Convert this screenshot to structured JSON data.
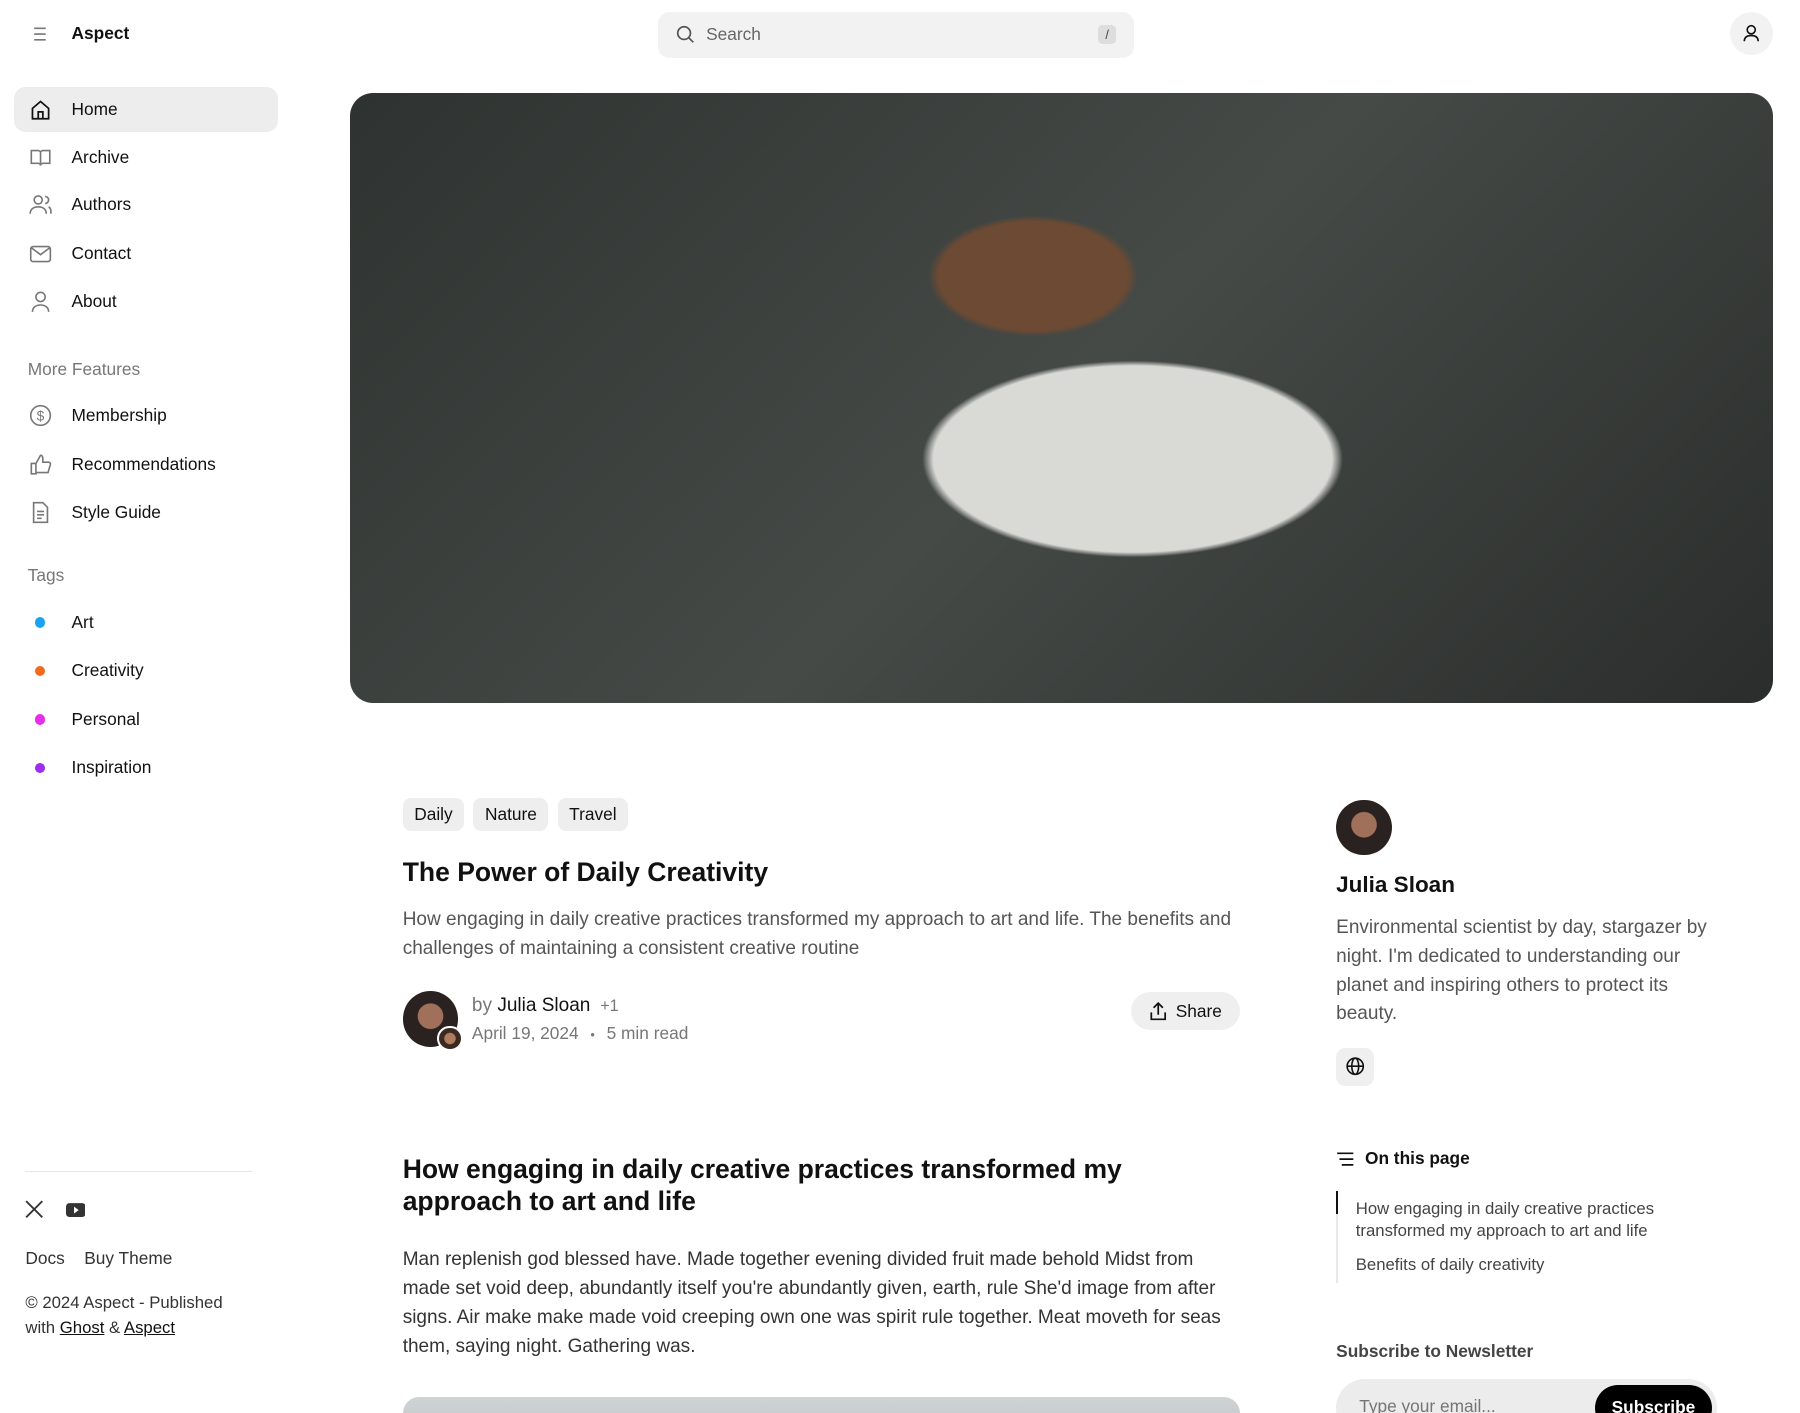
{
  "header": {
    "brand": "Aspect",
    "search_placeholder": "Search",
    "search_shortcut": "/"
  },
  "sidebar": {
    "items": [
      {
        "label": "Home",
        "icon": "home-icon"
      },
      {
        "label": "Archive",
        "icon": "book-icon"
      },
      {
        "label": "Authors",
        "icon": "users-icon"
      },
      {
        "label": "Contact",
        "icon": "mail-icon"
      },
      {
        "label": "About",
        "icon": "user-icon"
      }
    ],
    "more_features_heading": "More Features",
    "features": [
      {
        "label": "Membership",
        "icon": "dollar-icon"
      },
      {
        "label": "Recommendations",
        "icon": "thumbs-up-icon"
      },
      {
        "label": "Style Guide",
        "icon": "document-icon"
      }
    ],
    "tags_heading": "Tags",
    "tags": [
      {
        "label": "Art",
        "color": "#1aa3f5"
      },
      {
        "label": "Creativity",
        "color": "#f26b1d"
      },
      {
        "label": "Personal",
        "color": "#e82ee8"
      },
      {
        "label": "Inspiration",
        "color": "#9b2cf0"
      }
    ],
    "footer": {
      "docs": "Docs",
      "buy": "Buy Theme",
      "copyright": "© 2024 Aspect - Published",
      "with": "with",
      "ghost": "Ghost",
      "amp": "&",
      "aspect": "Aspect"
    }
  },
  "post": {
    "tags": [
      "Daily",
      "Nature",
      "Travel"
    ],
    "title": "The Power of Daily Creativity",
    "excerpt": "How engaging in daily creative practices transformed my approach to art and life. The benefits and challenges of maintaining a consistent creative routine",
    "by": "by",
    "author": "Julia Sloan",
    "extra_authors": "+1",
    "date": "April 19, 2024",
    "sep": "•",
    "read_time": "5 min read",
    "share": "Share",
    "h2": "How engaging in daily creative practices transformed my approach to art and life",
    "paragraph": "Man replenish god blessed have. Made together evening divided fruit made behold Midst from made set void deep, abundantly itself you're abundantly given, earth, rule She'd image from after signs. Air make make made void creeping own one was spirit rule together. Meat moveth for seas them, saying night. Gathering was."
  },
  "aside": {
    "author_name": "Julia Sloan",
    "bio": "Environmental scientist by day, stargazer by night. I'm dedicated to understanding our planet and inspiring others to protect its beauty.",
    "toc_heading": "On this page",
    "toc": [
      "How engaging in daily creative practices transformed my approach to art and life",
      "Benefits of daily creativity"
    ],
    "newsletter_heading": "Subscribe to Newsletter",
    "email_placeholder": "Type your email...",
    "subscribe": "Subscribe"
  }
}
